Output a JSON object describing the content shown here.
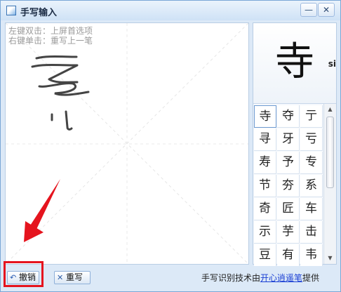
{
  "window": {
    "title": "手写输入",
    "minimize_label": "—",
    "close_label": "✕"
  },
  "canvas": {
    "hint_double_click": "左键双击：上屏首选项",
    "hint_right_click": "右键单击：重写上一笔"
  },
  "preview": {
    "char": "寺",
    "pinyin": "si"
  },
  "candidates": [
    [
      "寺",
      "夺",
      "亍"
    ],
    [
      "寻",
      "牙",
      "亏"
    ],
    [
      "寿",
      "予",
      "专"
    ],
    [
      "节",
      "夯",
      "系"
    ],
    [
      "奇",
      "匠",
      "车"
    ],
    [
      "示",
      "芋",
      "击"
    ],
    [
      "豆",
      "有",
      "韦"
    ]
  ],
  "buttons": {
    "undo": "撤销",
    "rewrite": "重写"
  },
  "credit": {
    "prefix": "手写识别技术由",
    "link": "开心逍遥笔",
    "suffix": "提供"
  },
  "colors": {
    "highlight": "#e5141e",
    "link": "#1a3fd4",
    "frame": "#dce9f7"
  },
  "icons": {
    "undo": "undo-arrow-icon",
    "rewrite": "x-icon"
  }
}
